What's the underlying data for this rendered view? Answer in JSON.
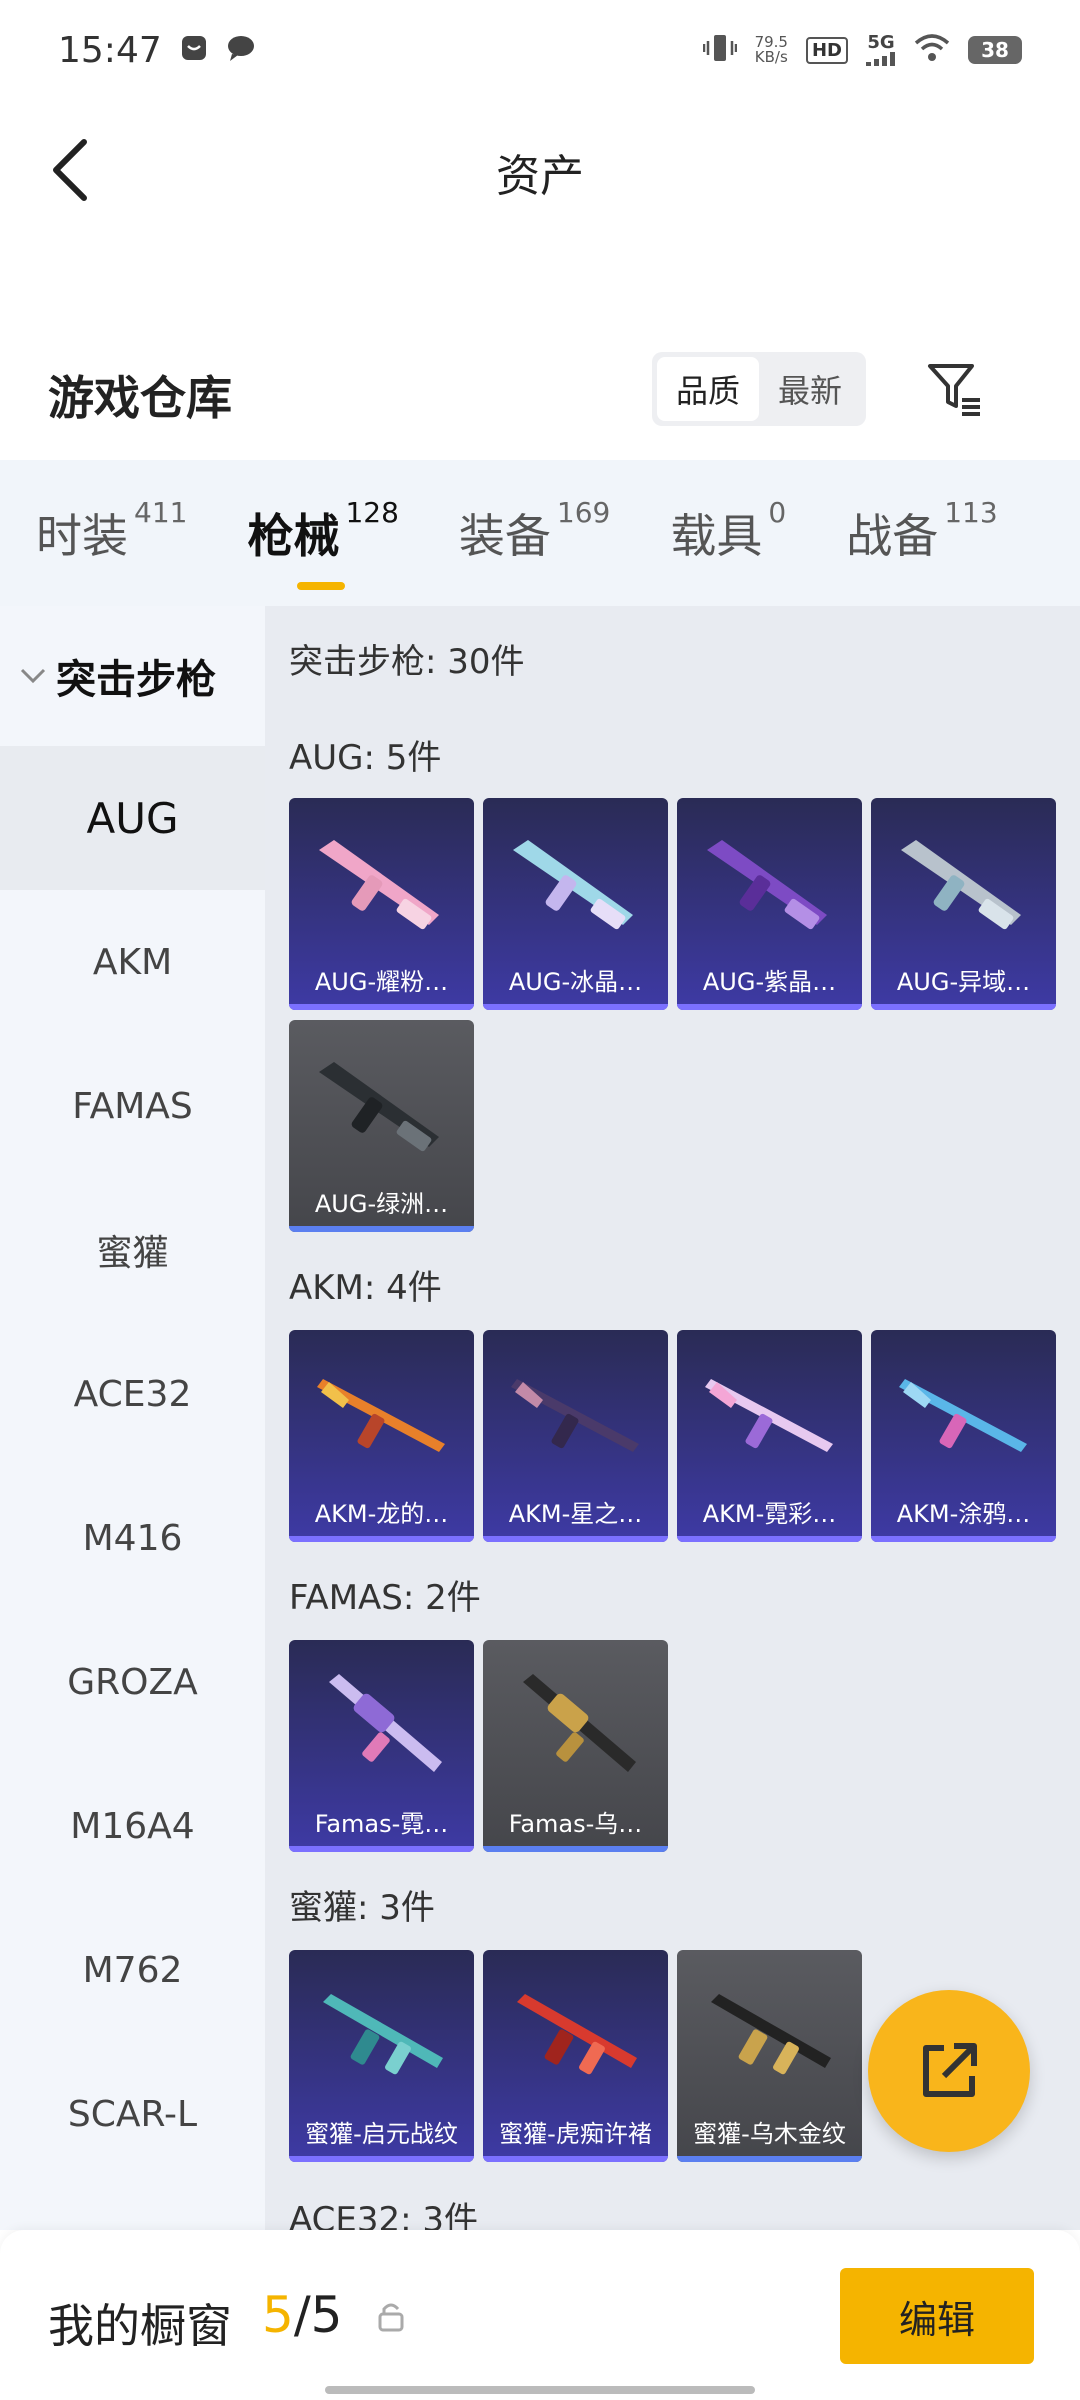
{
  "status_bar": {
    "time": "15:47",
    "net_speed_value": "79.5",
    "net_speed_unit": "KB/s",
    "hd_badge": "HD",
    "signal_label": "5G",
    "battery": "38"
  },
  "header": {
    "title": "资产"
  },
  "warehouse": {
    "title": "游戏仓库",
    "sort_options": [
      "品质",
      "最新"
    ],
    "sort_selected": "品质"
  },
  "tabs": [
    {
      "label": "时装",
      "count": "411"
    },
    {
      "label": "枪械",
      "count": "128"
    },
    {
      "label": "装备",
      "count": "169"
    },
    {
      "label": "载具",
      "count": "0"
    },
    {
      "label": "战备",
      "count": "113"
    }
  ],
  "active_tab": "枪械",
  "sidebar": {
    "category": "突击步枪",
    "items": [
      "AUG",
      "AKM",
      "FAMAS",
      "蜜獾",
      "ACE32",
      "M416",
      "GROZA",
      "M16A4",
      "M762",
      "SCAR-L"
    ],
    "selected": "AUG"
  },
  "content": {
    "category_summary": "突击步枪: 30件",
    "groups": [
      {
        "title": "AUG: 5件",
        "items": [
          "AUG-耀粉…",
          "AUG-冰晶…",
          "AUG-紫晶…",
          "AUG-异域…",
          "AUG-绿洲…"
        ]
      },
      {
        "title": "AKM: 4件",
        "items": [
          "AKM-龙的…",
          "AKM-星之…",
          "AKM-霓彩…",
          "AKM-涂鸦…"
        ]
      },
      {
        "title": "FAMAS: 2件",
        "items": [
          "Famas-霓…",
          "Famas-乌…"
        ]
      },
      {
        "title": "蜜獾: 3件",
        "items": [
          "蜜獾-启元战纹",
          "蜜獾-虎痴许褚",
          "蜜獾-乌木金纹"
        ]
      },
      {
        "title": "ACE32: 3件",
        "items": []
      }
    ]
  },
  "bottom_bar": {
    "showcase_label": "我的橱窗",
    "showcase_current": "5",
    "showcase_total": "/5",
    "edit_label": "编辑"
  },
  "colors": {
    "accent": "#f5b400",
    "card_purple": "#3e3aa5",
    "card_grey": "#4a4b50"
  }
}
